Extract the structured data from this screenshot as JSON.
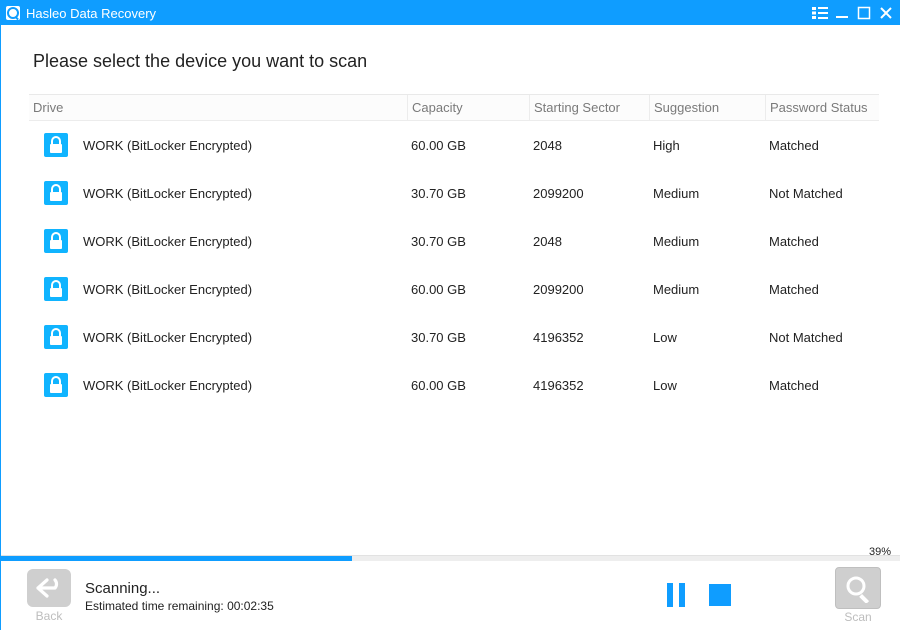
{
  "titlebar": {
    "title": "Hasleo Data Recovery"
  },
  "heading": "Please select the device you want to scan",
  "columns": {
    "drive": "Drive",
    "capacity": "Capacity",
    "starting_sector": "Starting Sector",
    "suggestion": "Suggestion",
    "password_status": "Password Status"
  },
  "rows": [
    {
      "name": "WORK (BitLocker Encrypted)",
      "capacity": "60.00 GB",
      "starting_sector": "2048",
      "suggestion": "High",
      "password_status": "Matched"
    },
    {
      "name": "WORK (BitLocker Encrypted)",
      "capacity": "30.70 GB",
      "starting_sector": "2099200",
      "suggestion": "Medium",
      "password_status": "Not Matched"
    },
    {
      "name": "WORK (BitLocker Encrypted)",
      "capacity": "30.70 GB",
      "starting_sector": "2048",
      "suggestion": "Medium",
      "password_status": "Matched"
    },
    {
      "name": "WORK (BitLocker Encrypted)",
      "capacity": "60.00 GB",
      "starting_sector": "2099200",
      "suggestion": "Medium",
      "password_status": "Matched"
    },
    {
      "name": "WORK (BitLocker Encrypted)",
      "capacity": "30.70 GB",
      "starting_sector": "4196352",
      "suggestion": "Low",
      "password_status": "Not Matched"
    },
    {
      "name": "WORK (BitLocker Encrypted)",
      "capacity": "60.00 GB",
      "starting_sector": "4196352",
      "suggestion": "Low",
      "password_status": "Matched"
    }
  ],
  "footer": {
    "back_label": "Back",
    "status": "Scanning...",
    "eta_prefix": "Estimated time remaining: ",
    "eta": "00:02:35",
    "scan_label": "Scan",
    "percent": 39,
    "percent_label": "39%"
  },
  "colors": {
    "accent": "#0f9dff"
  }
}
